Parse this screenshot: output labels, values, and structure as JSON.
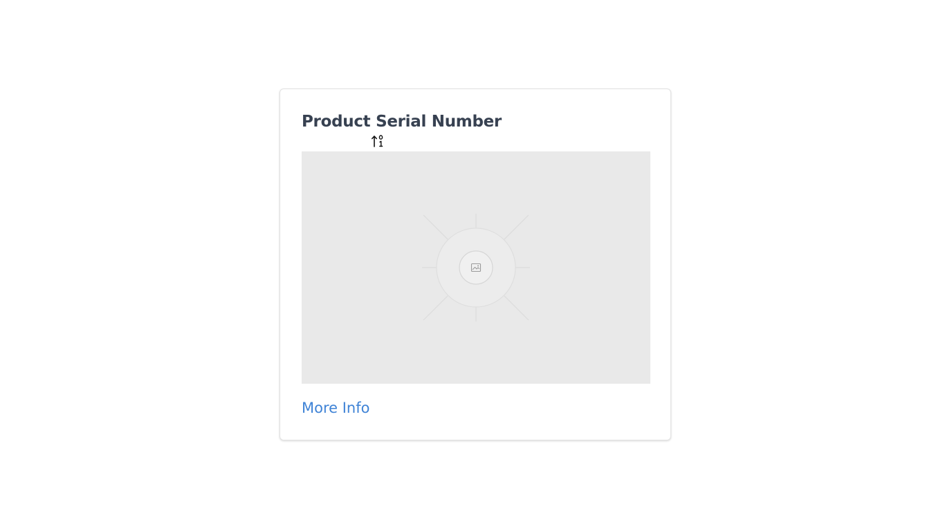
{
  "card": {
    "title": "Product Serial Number",
    "link_label": "More Info",
    "placeholder_icon": "image-icon",
    "sort_icon": "sort-ascending-numeric-icon"
  },
  "colors": {
    "title": "#374151",
    "link": "#3f83d6",
    "placeholder_bg": "#e9e9e9",
    "card_border": "#e2e2e2"
  }
}
